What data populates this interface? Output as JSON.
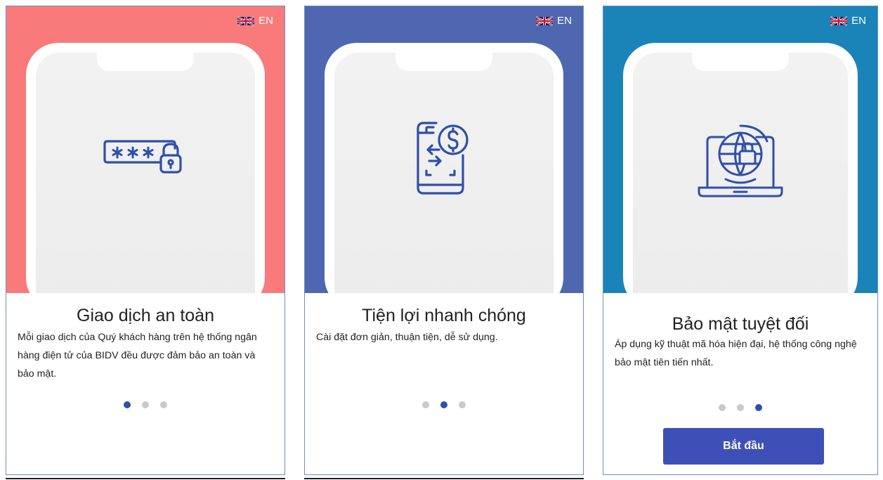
{
  "language": {
    "label": "EN",
    "flag_icon": "uk-flag-icon"
  },
  "screens": [
    {
      "title": "Giao dịch an toàn",
      "description": "Mỗi giao dịch của Quý khách hàng trên hệ thống ngân hàng điện tử của BIDV đều được đảm bảo an toàn và bảo mật.",
      "hero_color": "#f87a7a",
      "icon": "password-lock-icon",
      "active_dot": 0
    },
    {
      "title": "Tiện lợi nhanh chóng",
      "description": "Cài đặt đơn giản, thuận tiện, dễ sử dụng.",
      "hero_color": "#4e67b0",
      "icon": "mobile-transfer-icon",
      "active_dot": 1
    },
    {
      "title": "Bảo mật tuyệt đối",
      "description": "Áp dụng kỹ thuật mã hóa hiện đại, hệ thống công nghệ bảo mật tiên tiến nhất.",
      "hero_color": "#1a84b8",
      "icon": "laptop-globe-lock-icon",
      "active_dot": 2,
      "button_label": "Bắt đầu"
    }
  ],
  "colors": {
    "icon": "#2f4fa8",
    "dot_active": "#2f4fa8",
    "dot_inactive": "#c9c9c9",
    "button": "#3e4fb8"
  }
}
